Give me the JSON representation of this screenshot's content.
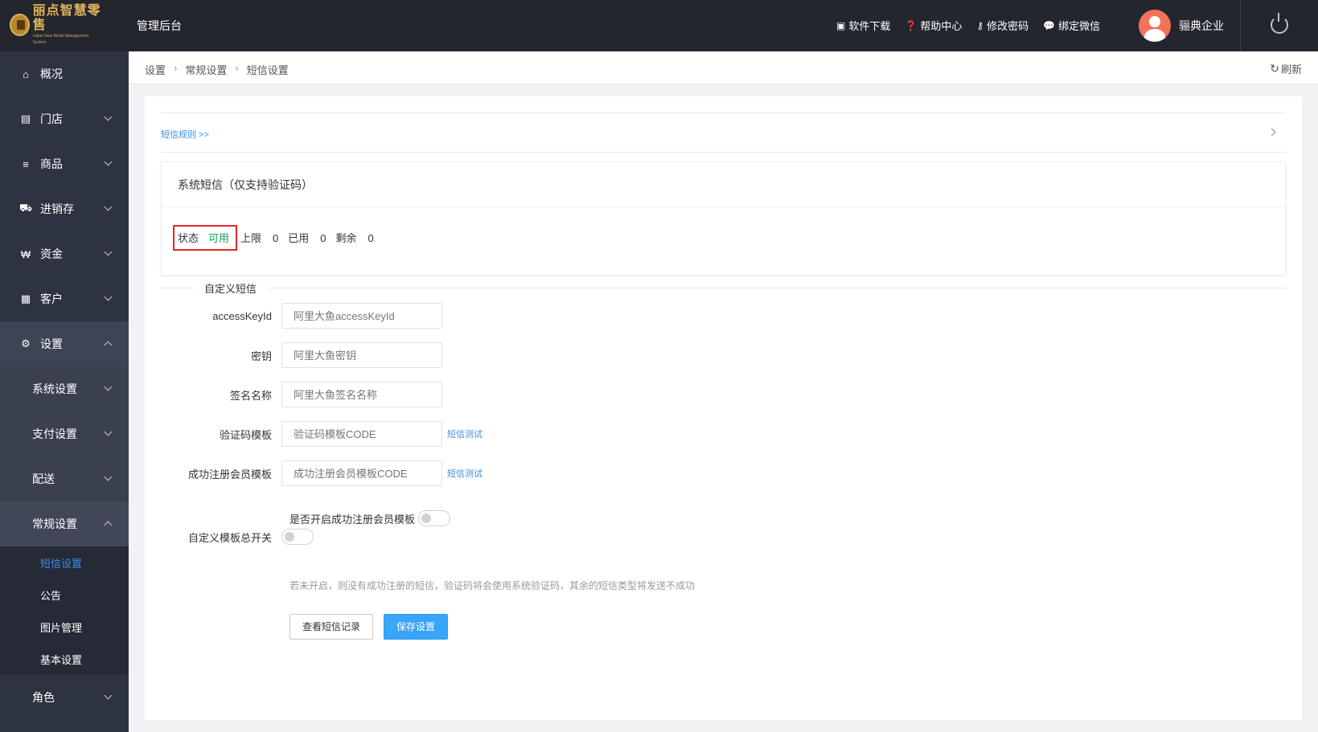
{
  "app": {
    "logo_title": "丽点智慧零售",
    "logo_sub": "Lidian New Retail Management System",
    "admin_title": "管理后台"
  },
  "topbar": {
    "links": [
      {
        "icon": "store-icon",
        "label": "软件下载"
      },
      {
        "icon": "help-icon",
        "label": "帮助中心"
      },
      {
        "icon": "key-icon",
        "label": "修改密码"
      },
      {
        "icon": "wechat-icon",
        "label": "绑定微信"
      }
    ],
    "user_name": "骊典企业"
  },
  "sidebar": {
    "items": [
      {
        "icon": "home-icon",
        "label": "概况"
      },
      {
        "icon": "store-icon",
        "label": "门店"
      },
      {
        "icon": "list-icon",
        "label": "商品"
      },
      {
        "icon": "truck-icon",
        "label": "进销存"
      },
      {
        "icon": "won-icon",
        "label": "资金"
      },
      {
        "icon": "id-card-icon",
        "label": "客户"
      },
      {
        "icon": "gear-icon",
        "label": "设置"
      }
    ],
    "settings_sub": [
      "系统设置",
      "支付设置",
      "配送",
      "常规设置"
    ],
    "general_leaves": [
      "短信设置",
      "公告",
      "图片管理",
      "基本设置"
    ],
    "bottom_item": "角色"
  },
  "breadcrumb": {
    "items": [
      "设置",
      "常规设置",
      "短信设置"
    ],
    "refresh_label": "刷新"
  },
  "sms": {
    "rule_link": "短信规则 >>",
    "system_title": "系统短信（仅支持验证码）",
    "stats": {
      "status_label": "状态",
      "status_value": "可用",
      "limit_label": "上限",
      "limit_value": "0",
      "used_label": "已用",
      "used_value": "0",
      "remain_label": "剩余",
      "remain_value": "0"
    },
    "custom_legend": "自定义短信",
    "fields": [
      {
        "label": "accessKeyId",
        "placeholder": "阿里大鱼accessKeyId",
        "value": ""
      },
      {
        "label": "密钥",
        "placeholder": "阿里大鱼密钥",
        "value": ""
      },
      {
        "label": "签名名称",
        "placeholder": "阿里大鱼签名名称",
        "value": ""
      },
      {
        "label": "验证码模板",
        "placeholder": "验证码模板CODE",
        "value": "",
        "test_label": "短信测试"
      },
      {
        "label": "成功注册会员模板",
        "placeholder": "成功注册会员模板CODE",
        "value": "",
        "test_label": "短信测试"
      }
    ],
    "register_switch_label": "是否开启成功注册会员模板",
    "register_switch_on": false,
    "master_switch_label": "自定义模板总开关",
    "master_switch_on": false,
    "hint": "若未开启，则没有成功注册的短信，验证码将会使用系统验证码，其余的短信类型将发送不成功",
    "btn_records": "查看短信记录",
    "btn_save": "保存设置"
  },
  "colors": {
    "topbar_bg": "#23262e",
    "sidebar_bg": "#2d3341",
    "link_blue": "#3a8ee6",
    "ok_green": "#19a05b",
    "highlight_red": "#e8262b",
    "primary_btn": "#3aa4f6"
  }
}
